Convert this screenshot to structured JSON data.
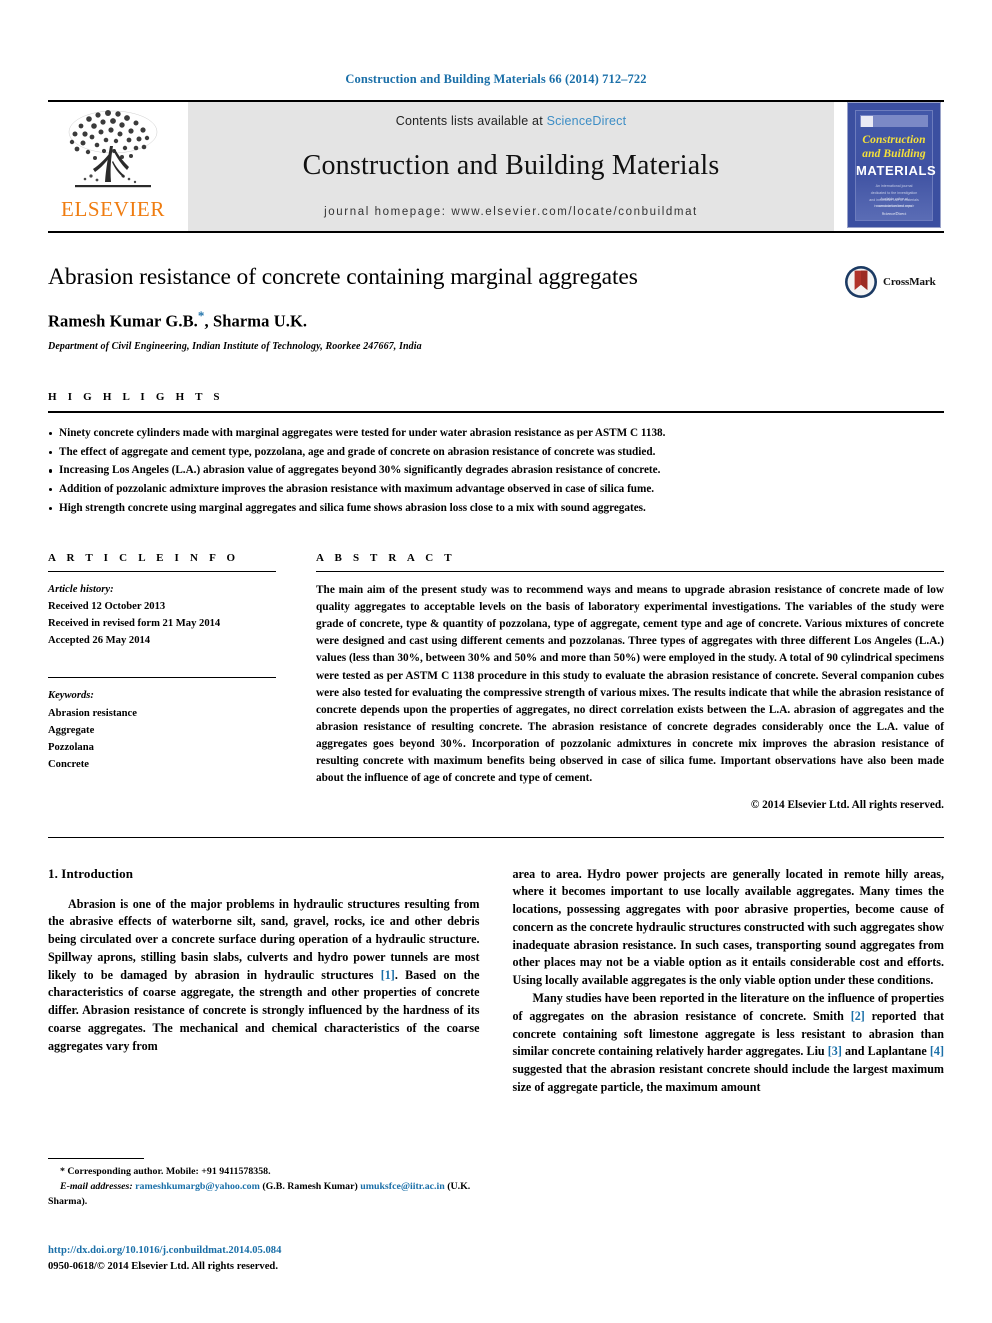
{
  "running_head": "Construction and Building Materials 66 (2014) 712–722",
  "masthead": {
    "publisher_name": "ELSEVIER",
    "contents_prefix": "Contents lists available at",
    "contents_link": "ScienceDirect",
    "journal_title": "Construction and Building Materials",
    "homepage": "journal homepage: www.elsevier.com/locate/conbuildmat",
    "cover": {
      "line1": "Construction",
      "line2": "and Building",
      "line3": "MATERIALS",
      "blurb": "An international journal dedicated to the investigation and innovative use of materials in construction and repair",
      "foot": "Available online at www.sciencedirect.com",
      "foot2": "ScienceDirect"
    }
  },
  "article": {
    "title": "Abrasion resistance of concrete containing marginal aggregates",
    "authors": "Ramesh Kumar G.B.",
    "authors_suffix": ", Sharma U.K.",
    "corresponding_marker": "*",
    "affiliation": "Department of Civil Engineering, Indian Institute of Technology, Roorkee 247667, India",
    "crossmark_label": "CrossMark"
  },
  "highlights": {
    "heading": "H I G H L I G H T S",
    "items": [
      "Ninety concrete cylinders made with marginal aggregates were tested for under water abrasion resistance as per ASTM C 1138.",
      "The effect of aggregate and cement type, pozzolana, age and grade of concrete on abrasion resistance of concrete was studied.",
      "Increasing Los Angeles (L.A.) abrasion value of aggregates beyond 30% significantly degrades abrasion resistance of concrete.",
      "Addition of pozzolanic admixture improves the abrasion resistance with maximum advantage observed in case of silica fume.",
      "High strength concrete using marginal aggregates and silica fume shows abrasion loss close to a mix with sound aggregates."
    ]
  },
  "article_info": {
    "heading": "A R T I C L E    I N F O",
    "history_label": "Article history:",
    "history": [
      "Received 12 October 2013",
      "Received in revised form 21 May 2014",
      "Accepted 26 May 2014"
    ],
    "keywords_label": "Keywords:",
    "keywords": [
      "Abrasion resistance",
      "Aggregate",
      "Pozzolana",
      "Concrete"
    ]
  },
  "abstract": {
    "heading": "A B S T R A C T",
    "text": "The main aim of the present study was to recommend ways and means to upgrade abrasion resistance of concrete made of low quality aggregates to acceptable levels on the basis of laboratory experimental investigations. The variables of the study were grade of concrete, type & quantity of pozzolana, type of aggregate, cement type and age of concrete. Various mixtures of concrete were designed and cast using different cements and pozzolanas. Three types of aggregates with three different Los Angeles (L.A.) values (less than 30%, between 30% and 50% and more than 50%) were employed in the study. A total of 90 cylindrical specimens were tested as per ASTM C 1138 procedure in this study to evaluate the abrasion resistance of concrete. Several companion cubes were also tested for evaluating the compressive strength of various mixes. The results indicate that while the abrasion resistance of concrete depends upon the properties of aggregates, no direct correlation exists between the L.A. abrasion of aggregates and the abrasion resistance of resulting concrete. The abrasion resistance of concrete degrades considerably once the L.A. value of aggregates goes beyond 30%. Incorporation of pozzolanic admixtures in concrete mix improves the abrasion resistance of resulting concrete with maximum benefits being observed in case of silica fume. Important observations have also been made about the influence of age of concrete and type of cement.",
    "copyright": "© 2014 Elsevier Ltd. All rights reserved."
  },
  "introduction": {
    "heading": "1. Introduction",
    "left_p1": "Abrasion is one of the major problems in hydraulic structures resulting from the abrasive effects of waterborne silt, sand, gravel, rocks, ice and other debris being circulated over a concrete surface during operation of a hydraulic structure. Spillway aprons, stilling basin slabs, culverts and hydro power tunnels are most likely to be damaged by abrasion in hydraulic structures ",
    "left_ref1": "[1]",
    "left_p1_cont": ". Based on the characteristics of coarse aggregate, the strength and other properties of concrete differ. Abrasion resistance of concrete is strongly influenced by the hardness of its coarse aggregates. The mechanical and chemical characteristics of the coarse aggregates vary from",
    "right_p1": "area to area. Hydro power projects are generally located in remote hilly areas, where it becomes important to use locally available aggregates. Many times the locations, possessing aggregates with poor abrasive properties, become cause of concern as the concrete hydraulic structures constructed with such aggregates show inadequate abrasion resistance. In such cases, transporting sound aggregates from other places may not be a viable option as it entails considerable cost and efforts. Using locally available aggregates is the only viable option under these conditions.",
    "right_p2_a": "Many studies have been reported in the literature on the influence of properties of aggregates on the abrasion resistance of concrete. Smith ",
    "right_ref2": "[2]",
    "right_p2_b": " reported that concrete containing soft limestone aggregate is less resistant to abrasion than similar concrete containing relatively harder aggregates. Liu ",
    "right_ref3": "[3]",
    "right_p2_c": " and Laplantane ",
    "right_ref4": "[4]",
    "right_p2_d": " suggested that the abrasion resistant concrete should include the largest maximum size of aggregate particle, the maximum amount"
  },
  "footnotes": {
    "corresponding": "Corresponding author. Mobile: +91 9411578358.",
    "corresponding_marker": "*",
    "email_label": "E-mail addresses:",
    "email1": "rameshkumargb@yahoo.com",
    "email1_owner": "(G.B. Ramesh Kumar)",
    "email2": "umuksfce@iitr.ac.in",
    "email2_owner": "(U.K. Sharma)."
  },
  "doi_block": {
    "doi": "http://dx.doi.org/10.1016/j.conbuildmat.2014.05.084",
    "issn": "0950-0618/© 2014 Elsevier Ltd. All rights reserved."
  },
  "colors": {
    "link_blue": "#1a6fa8",
    "sciencedirect_blue": "#3c8dc5",
    "elsevier_orange": "#ef7c10",
    "band_grey": "#e4e4e4",
    "cover_blue": "#3b4fa0",
    "crossmark_red": "#b0332a"
  }
}
